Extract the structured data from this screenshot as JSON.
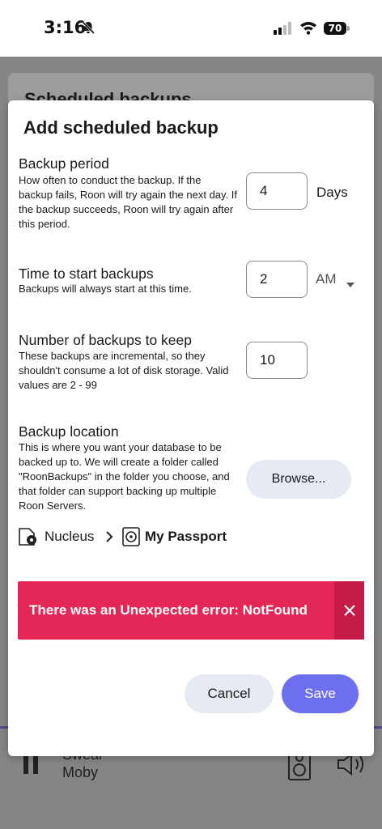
{
  "status_bar": {
    "time": "3:16",
    "battery": "70",
    "icons": [
      "bell-off-icon",
      "cellular-signal-icon",
      "wifi-icon",
      "battery-icon"
    ]
  },
  "background": {
    "title": "Scheduled backups",
    "now_playing": {
      "title": "Swear",
      "artist": "Moby"
    }
  },
  "dialog": {
    "title": "Add scheduled backup",
    "backup_period": {
      "title": "Backup period",
      "description": "How often to conduct the backup. If the backup fails, Roon will try again the next day. If the backup succeeds, Roon will try again after this period.",
      "value": "4",
      "unit": "Days"
    },
    "start_time": {
      "title": "Time to start backups",
      "description": "Backups will always start at this time.",
      "value": "2",
      "meridiem": "AM"
    },
    "backups_to_keep": {
      "title": "Number of backups to keep",
      "description": "These backups are incremental, so they shouldn't consume a lot of disk storage. Valid values are 2 - 99",
      "value": "10"
    },
    "backup_location": {
      "title": "Backup location",
      "description": "This is where you want your database to be backed up to. We will create a folder called \"RoonBackups\" in the folder you choose, and that folder can support backing up multiple Roon Servers.",
      "browse_label": "Browse...",
      "path": {
        "device": "Nucleus",
        "drive": "My Passport"
      }
    },
    "error": {
      "message": "There was an Unexpected error: NotFound"
    },
    "buttons": {
      "cancel": "Cancel",
      "save": "Save"
    }
  },
  "colors": {
    "error": "#e52757",
    "error_close": "#c41c47",
    "primary": "#6e6ff0",
    "secondary_button": "#e5eaf3"
  }
}
